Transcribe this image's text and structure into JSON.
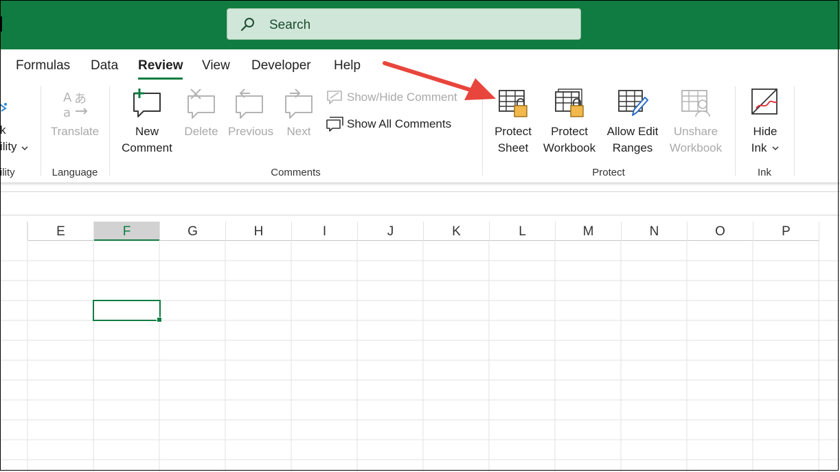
{
  "search": {
    "placeholder": "Search"
  },
  "tabs": [
    {
      "label": "Formulas"
    },
    {
      "label": "Data"
    },
    {
      "label": "Review",
      "active": true
    },
    {
      "label": "View"
    },
    {
      "label": "Developer"
    },
    {
      "label": "Help"
    }
  ],
  "ribbon": {
    "accessibility": {
      "partial_line1": "k",
      "partial_line2": "ility",
      "group_partial": "ility"
    },
    "language": {
      "group": "Language",
      "translate": "Translate"
    },
    "comments": {
      "group": "Comments",
      "new_comment_line1": "New",
      "new_comment_line2": "Comment",
      "delete": "Delete",
      "previous": "Previous",
      "next": "Next",
      "show_hide": "Show/Hide Comment",
      "show_all": "Show All Comments"
    },
    "protect": {
      "group": "Protect",
      "protect_sheet_line1": "Protect",
      "protect_sheet_line2": "Sheet",
      "protect_workbook_line1": "Protect",
      "protect_workbook_line2": "Workbook",
      "allow_edit_line1": "Allow Edit",
      "allow_edit_line2": "Ranges",
      "unshare_line1": "Unshare",
      "unshare_line2": "Workbook"
    },
    "ink": {
      "group": "Ink",
      "hide_ink_line1": "Hide",
      "hide_ink_line2": "Ink"
    }
  },
  "columns": [
    "E",
    "F",
    "G",
    "H",
    "I",
    "J",
    "K",
    "L",
    "M",
    "N",
    "O",
    "P"
  ],
  "selected_column": "F",
  "colors": {
    "brand": "#107c41",
    "arrow": "#e8453c",
    "lock": "#f2b84b"
  }
}
